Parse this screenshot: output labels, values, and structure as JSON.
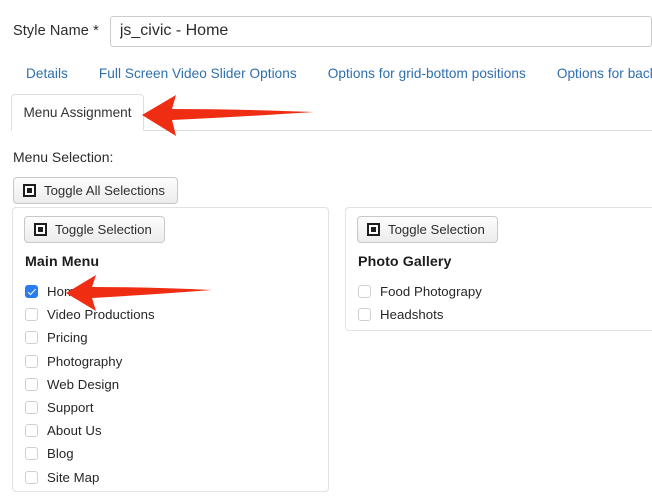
{
  "form": {
    "style_name_label": "Style Name *",
    "style_name_value": "js_civic - Home",
    "style_name_placeholder": "Style Name"
  },
  "tabs": {
    "row1": [
      {
        "label": "Details"
      },
      {
        "label": "Full Screen Video Slider Options"
      },
      {
        "label": "Options for grid-bottom positions"
      },
      {
        "label": "Options for backgrou"
      }
    ],
    "active_tab": "Menu Assignment"
  },
  "menu_selection": {
    "label": "Menu Selection:",
    "toggle_all_label": "Toggle All Selections"
  },
  "panels": [
    {
      "toggle_label": "Toggle Selection",
      "heading": "Main Menu",
      "items": [
        {
          "label": "Home",
          "checked": true
        },
        {
          "label": "Video Productions",
          "checked": false
        },
        {
          "label": "Pricing",
          "checked": false
        },
        {
          "label": "Photography",
          "checked": false
        },
        {
          "label": "Web Design",
          "checked": false
        },
        {
          "label": "Support",
          "checked": false
        },
        {
          "label": "About Us",
          "checked": false
        },
        {
          "label": "Blog",
          "checked": false
        },
        {
          "label": "Site Map",
          "checked": false
        }
      ]
    },
    {
      "toggle_label": "Toggle Selection",
      "heading": "Photo Gallery",
      "items": [
        {
          "label": "Food Photograpy",
          "checked": false
        },
        {
          "label": "Headshots",
          "checked": false
        }
      ]
    }
  ],
  "annotations": {
    "arrow_color": "#ee2d12",
    "arrows": [
      {
        "name": "arrow-pointing-at-menu-assignment-tab",
        "direction": "left"
      },
      {
        "name": "arrow-pointing-at-home-checkbox",
        "direction": "left"
      }
    ]
  },
  "colors": {
    "tab_link": "#2f6fae",
    "checkbox_checked": "#2b7cf0",
    "panel_border": "#e2e2e2",
    "arrow_red": "#ee2d12"
  }
}
